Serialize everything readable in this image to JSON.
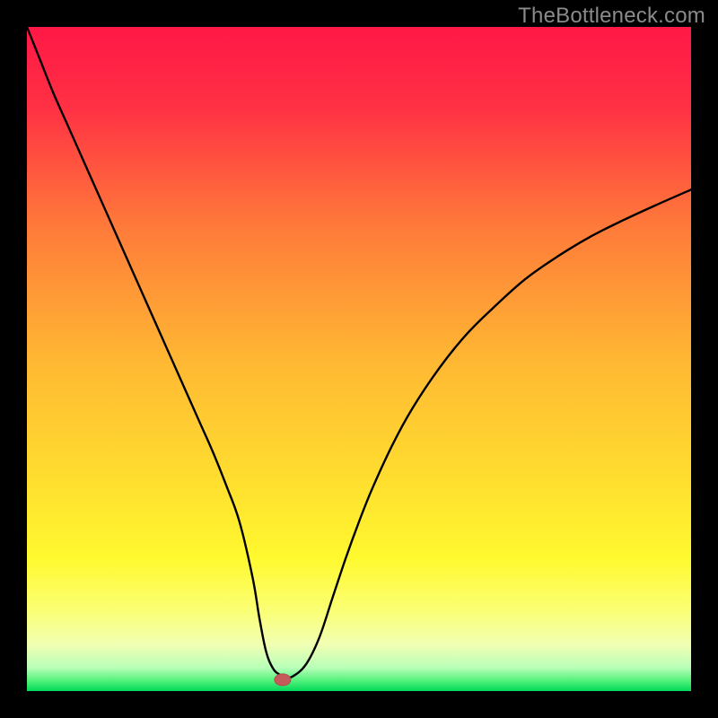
{
  "watermark": "TheBottleneck.com",
  "colors": {
    "border": "#000000",
    "gradient_stops": [
      {
        "offset": 0.0,
        "color": "#ff1846"
      },
      {
        "offset": 0.12,
        "color": "#ff3044"
      },
      {
        "offset": 0.3,
        "color": "#ff7a3a"
      },
      {
        "offset": 0.5,
        "color": "#ffb733"
      },
      {
        "offset": 0.7,
        "color": "#ffe22f"
      },
      {
        "offset": 0.8,
        "color": "#fff92f"
      },
      {
        "offset": 0.88,
        "color": "#fbff76"
      },
      {
        "offset": 0.93,
        "color": "#f1ffb3"
      },
      {
        "offset": 0.965,
        "color": "#b8ffb8"
      },
      {
        "offset": 0.985,
        "color": "#4ef179"
      },
      {
        "offset": 1.0,
        "color": "#00d85a"
      }
    ],
    "curve": "#000000",
    "marker_fill": "#c55a5a",
    "marker_stroke": "#b34d4d"
  },
  "chart_data": {
    "type": "line",
    "title": "",
    "xlabel": "",
    "ylabel": "",
    "xlim": [
      0,
      100
    ],
    "ylim": [
      0,
      100
    ],
    "x": [
      0,
      2,
      4,
      6,
      8,
      10,
      12,
      14,
      16,
      18,
      20,
      22,
      24,
      26,
      28,
      30,
      32,
      34,
      35,
      36,
      37,
      38,
      39,
      40,
      42,
      44,
      46,
      48,
      50,
      52,
      55,
      58,
      62,
      66,
      70,
      75,
      80,
      85,
      90,
      95,
      100
    ],
    "values": [
      100,
      95,
      90,
      85.5,
      81,
      76.5,
      72,
      67.5,
      63,
      58.5,
      54,
      49.5,
      45,
      40.5,
      36,
      31,
      25.5,
      17,
      11,
      6,
      3.5,
      2.5,
      2.2,
      2.2,
      4,
      8,
      14,
      20,
      25.5,
      30.5,
      37,
      42.5,
      48.5,
      53.5,
      57.5,
      62,
      65.5,
      68.5,
      71,
      73.3,
      75.5
    ],
    "marker": {
      "x": 38.5,
      "y": 1.7
    }
  }
}
